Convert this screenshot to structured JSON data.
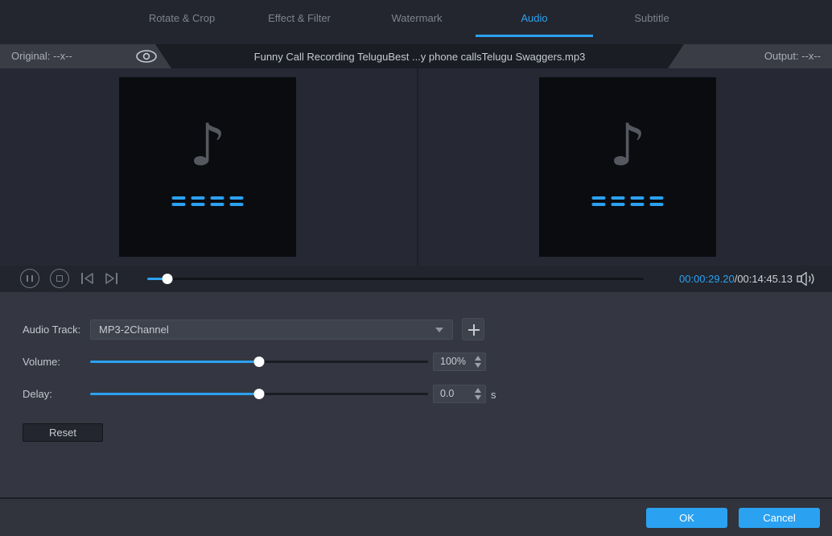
{
  "tabs": {
    "items": [
      {
        "label": "Rotate & Crop",
        "active": false
      },
      {
        "label": "Effect & Filter",
        "active": false
      },
      {
        "label": "Watermark",
        "active": false
      },
      {
        "label": "Audio",
        "active": true
      },
      {
        "label": "Subtitle",
        "active": false
      }
    ]
  },
  "file_bar": {
    "original_label": "Original: --x--",
    "filename": "Funny Call Recording TeluguBest ...y phone callsTelugu Swaggers.mp3",
    "output_label": "Output: --x--"
  },
  "preview": {
    "music_note_glyph": "♪"
  },
  "player": {
    "current_time": "00:00:29.20",
    "separator": "/",
    "total_time": "00:14:45.13",
    "progress_percent": 4.05
  },
  "audio_controls": {
    "track_label": "Audio Track:",
    "track_value": "MP3-2Channel",
    "volume_label": "Volume:",
    "volume_value": "100%",
    "volume_percent": 50,
    "delay_label": "Delay:",
    "delay_value": "0.0",
    "delay_unit": "s",
    "delay_percent": 50,
    "reset_label": "Reset"
  },
  "footer": {
    "ok_label": "OK",
    "cancel_label": "Cancel"
  },
  "icons": {
    "preview_toggle": "eye-icon",
    "pause": "pause-icon",
    "stop": "stop-icon",
    "previous": "skip-previous-icon",
    "next": "skip-next-icon",
    "volume": "speaker-icon",
    "dropdown": "chevron-down-icon",
    "add_track": "plus-icon"
  },
  "colors": {
    "accent_blue": "#2ba1f1",
    "topbar_bg": "#23262e",
    "panel_bg": "#343741",
    "preview_bg": "#262933",
    "thumb_bg": "#0b0c10",
    "strip_light": "#3a3d46",
    "strip_dark": "#1a1d24"
  }
}
